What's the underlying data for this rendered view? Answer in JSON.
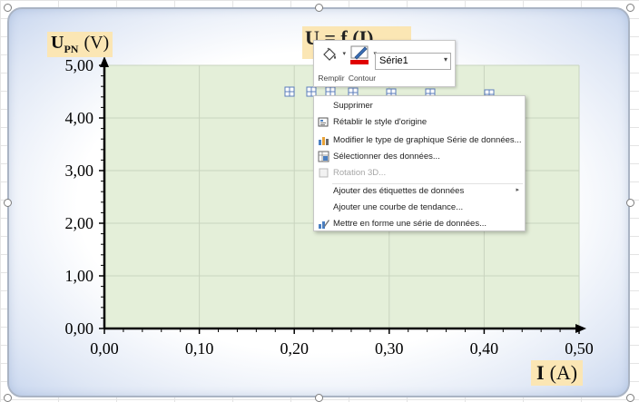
{
  "chart_data": {
    "type": "scatter",
    "title": "U   = f (I)",
    "ylabel_main": "U",
    "ylabel_sub": "PN",
    "ylabel_unit": "(V)",
    "xlabel_main": "I",
    "xlabel_unit": "(A)",
    "xlim": [
      0,
      0.5
    ],
    "ylim": [
      0,
      5
    ],
    "x_ticks": [
      "0,00",
      "0,10",
      "0,20",
      "0,30",
      "0,40",
      "0,50"
    ],
    "y_ticks": [
      "0,00",
      "1,00",
      "2,00",
      "3,00",
      "4,00",
      "5,00"
    ],
    "grid": true,
    "points": [
      {
        "x": 0.195,
        "y": 4.5
      },
      {
        "x": 0.218,
        "y": 4.5
      },
      {
        "x": 0.238,
        "y": 4.5
      },
      {
        "x": 0.262,
        "y": 4.48
      },
      {
        "x": 0.302,
        "y": 4.47
      },
      {
        "x": 0.343,
        "y": 4.46
      },
      {
        "x": 0.405,
        "y": 4.44
      }
    ],
    "series": [
      {
        "name": "Série1"
      }
    ],
    "colors": {
      "plot_bg": "#e4efd9",
      "title_bg": "#fbe6b4",
      "marker": "#5b7dbb"
    }
  },
  "toolbar": {
    "fill_label": "Remplir",
    "outline_label": "Contour",
    "series_selected": "Série1",
    "outline_color": "#e00000"
  },
  "context_menu": {
    "items": [
      {
        "label": "Supprimer",
        "icon": "none",
        "enabled": true,
        "submenu": false
      },
      {
        "label": "Rétablir le style d'origine",
        "icon": "reset-style-icon",
        "enabled": true,
        "submenu": false
      },
      {
        "label": "Modifier le type de graphique Série de données...",
        "icon": "chart-type-icon",
        "enabled": true,
        "submenu": false
      },
      {
        "label": "Sélectionner des données...",
        "icon": "select-data-icon",
        "enabled": true,
        "submenu": false
      },
      {
        "label": "Rotation 3D...",
        "icon": "rotation-3d-icon",
        "enabled": false,
        "submenu": false
      },
      {
        "label": "Ajouter des étiquettes de données",
        "icon": "none",
        "enabled": true,
        "submenu": true
      },
      {
        "label": "Ajouter une courbe de tendance...",
        "icon": "none",
        "enabled": true,
        "submenu": false
      },
      {
        "label": "Mettre en forme une série de données...",
        "icon": "format-series-icon",
        "enabled": true,
        "submenu": false
      }
    ]
  }
}
